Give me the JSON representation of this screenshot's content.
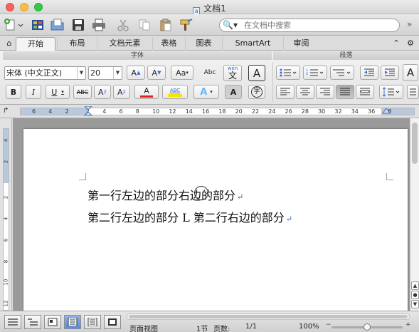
{
  "window": {
    "title": "文档1"
  },
  "toolbar": {
    "search": {
      "placeholder": "在文档中搜索"
    },
    "icons": [
      "new-icon",
      "gallery-icon",
      "open-icon",
      "save-icon",
      "print-icon",
      "cut-icon",
      "copy-icon",
      "paste-icon",
      "format-painter-icon",
      "search-icon"
    ]
  },
  "tabs": [
    "开始",
    "布局",
    "文档元素",
    "表格",
    "图表",
    "SmartArt",
    "审阅"
  ],
  "ribbon": {
    "font_group_label": "字体",
    "paragraph_group_label": "段落",
    "font_name": "宋体 (中文正文)",
    "font_size": "20",
    "buttons": {
      "bold": "B",
      "italic": "I",
      "underline": "U",
      "strikethrough": "ABC",
      "superscript_base": "A",
      "superscript_mark": "2",
      "subscript_base": "A",
      "subscript_mark": "2",
      "font_color": "A",
      "highlight": "ABC",
      "text_effects": "A",
      "character_shading": "A",
      "enclose_char": "字",
      "grow_font": "A",
      "shrink_font": "A",
      "change_case": "Aa",
      "clear_format": "Abc",
      "phonetic_top": "wén",
      "phonetic_bottom": "文",
      "char_border": "A",
      "style_preview": "A"
    }
  },
  "ruler": {
    "numbers": [
      "6",
      "4",
      "2",
      "2",
      "4",
      "6",
      "8",
      "10",
      "12",
      "14",
      "16",
      "18",
      "20",
      "22",
      "24",
      "26",
      "28",
      "30",
      "32",
      "34",
      "36",
      "38"
    ],
    "vertical_numbers": [
      "4",
      "2",
      "2",
      "4",
      "6",
      "8",
      "10",
      "12"
    ]
  },
  "document": {
    "line1_part1": "第一行左边的部分",
    "line1_part2": "右边的部分",
    "line2": "第二行左边的部分 L 第二行右边的部分",
    "paragraph_mark": "↵"
  },
  "status": {
    "view": "页面视图",
    "section": "1节",
    "pages_label": "页数:",
    "pages": "1/1",
    "zoom": "100%",
    "zoom_level": 0.5
  },
  "colors": {
    "font_color_bar": "#e02020",
    "highlight_bar": "#f5e400",
    "accent_blue": "#3b6fd4",
    "text_effects": "#6fb8f0"
  }
}
